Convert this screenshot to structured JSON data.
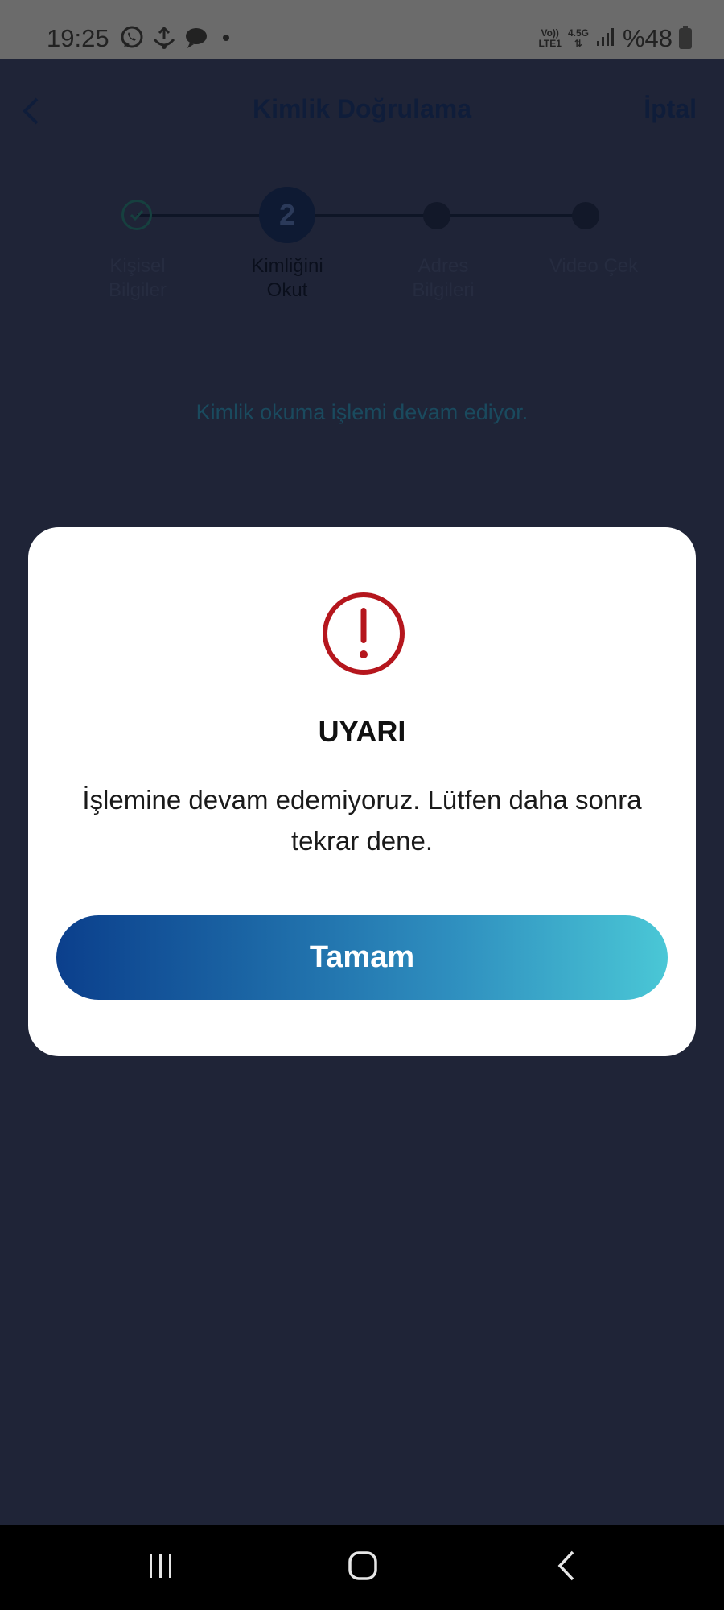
{
  "status_bar": {
    "time": "19:25",
    "network_top": "Vo))",
    "network_bottom": "LTE1",
    "network_gen": "4.5G",
    "battery": "%48",
    "icons": [
      "whatsapp-icon",
      "app-notification-icon",
      "message-bubble-icon",
      "dot-icon",
      "signal-icon",
      "battery-icon"
    ]
  },
  "header": {
    "title": "Kimlik Doğrulama",
    "cancel_label": "İptal",
    "back_icon": "chevron-left-icon"
  },
  "stepper": {
    "steps": [
      {
        "label_line1": "Kişisel",
        "label_line2": "Bilgiler",
        "state": "completed"
      },
      {
        "label_line1": "Kimliğini",
        "label_line2": "Okut",
        "state": "active",
        "number": "2"
      },
      {
        "label_line1": "Adres",
        "label_line2": "Bilgileri",
        "state": "pending"
      },
      {
        "label_line1": "Video Çek",
        "label_line2": "",
        "state": "pending"
      }
    ]
  },
  "progress_message": "Kimlik okuma işlemi devam ediyor.",
  "dialog": {
    "icon": "exclamation-circle-icon",
    "title": "UYARI",
    "message": "İşlemine devam edemiyoruz. Lütfen daha sonra tekrar dene.",
    "ok_label": "Tamam"
  },
  "colors": {
    "backdrop": "#1f2437",
    "dialog_bg": "#ffffff",
    "warning_red": "#b5161d",
    "button_gradient_start": "#0b3f8c",
    "button_gradient_end": "#4ac7d6"
  },
  "nav_bar": {
    "icons": [
      "recent-apps-icon",
      "home-icon",
      "back-icon"
    ]
  }
}
